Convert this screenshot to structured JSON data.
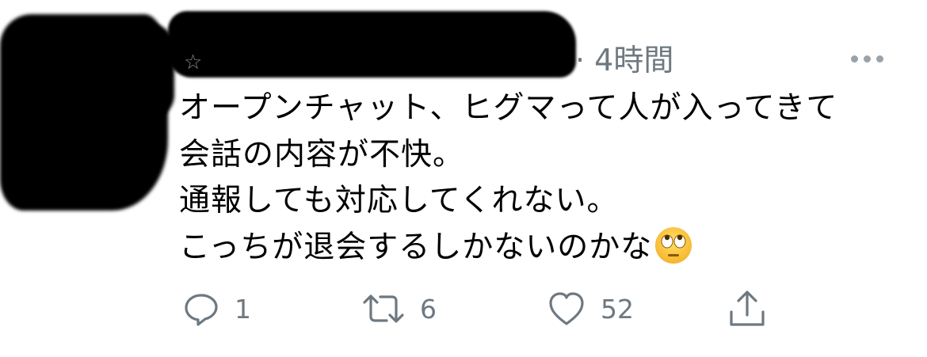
{
  "tweet": {
    "time": "· 4時間",
    "lines": [
      "オープンチャット、ヒグマって人が入ってきて",
      "会話の内容が不快。",
      "通報しても対応してくれない。",
      "こっちが退会するしかないのかな"
    ]
  },
  "actions": {
    "reply_count": "1",
    "retweet_count": "6",
    "like_count": "52"
  },
  "icons": {
    "emoji": "face-with-rolling-eyes-emoji",
    "reply": "reply-icon",
    "retweet": "retweet-icon",
    "like": "heart-icon",
    "share": "share-icon",
    "more": "more-icon"
  },
  "colors": {
    "secondary_text": "#6e7880",
    "icon": "#6e7880"
  }
}
